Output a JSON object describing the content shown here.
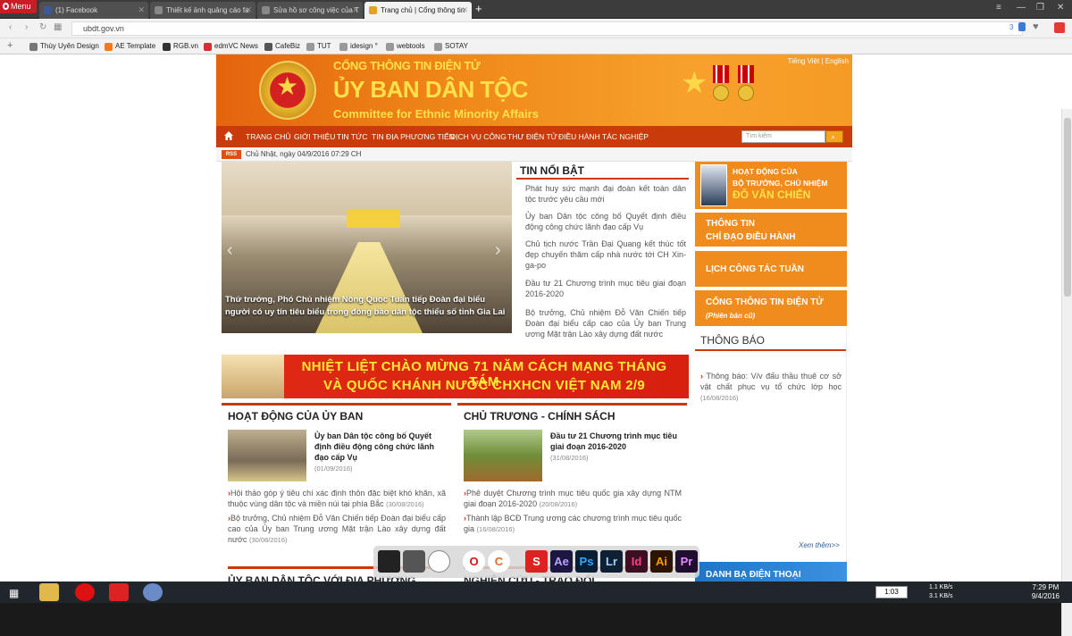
{
  "browser": {
    "menu_label": "Menu",
    "tabs": [
      {
        "label": "(1) Facebook",
        "color": "#3b5998"
      },
      {
        "label": "Thiết kế ảnh quảng cáo fa",
        "color": "#888888"
      },
      {
        "label": "Sửa hồ sơ công việc của T",
        "color": "#888888"
      },
      {
        "label": "Trang chủ | Cổng thông tin",
        "color": "#e8a020"
      }
    ],
    "new_tab": "+",
    "url": "ubdt.gov.vn",
    "badge_count": "3",
    "bookmarks": [
      {
        "label": "Thùy Uyên Design",
        "color": "#777777"
      },
      {
        "label": "AE Template",
        "color": "#f07b1e"
      },
      {
        "label": "RGB.vn",
        "color": "#333333"
      },
      {
        "label": "edmVC News",
        "color": "#d32f2f"
      },
      {
        "label": "CafeBiz",
        "color": "#555555"
      },
      {
        "label": "TUT",
        "color": "#777777"
      },
      {
        "label": "idesign °",
        "color": "#777777"
      },
      {
        "label": "webtools",
        "color": "#777777"
      },
      {
        "label": "SOTAY",
        "color": "#777777"
      }
    ]
  },
  "site": {
    "banner": {
      "line1": "CỔNG THÔNG TIN ĐIỆN TỬ",
      "line2": "ỦY BAN DÂN TỘC",
      "line3": "Committee for Ethnic Minority Affairs",
      "lang_vi": "Tiếng Việt",
      "lang_sep": "|",
      "lang_en": "English"
    },
    "nav": [
      "TRANG CHỦ",
      "GIỚI THIỆU",
      "TIN TỨC",
      "TIN ĐỊA PHƯƠNG TIỂN",
      "DỊCH VỤ CÔNG",
      "THƯ ĐIỆN TỬ",
      "ĐIỀU HÀNH TÁC NGHIỆP"
    ],
    "search_placeholder": "Tìm kiếm",
    "rss": "RSS",
    "date": "Chủ Nhật, ngày 04/9/2016 07:29 CH",
    "slider_caption": "Thứ trưởng, Phó Chủ nhiệm Nông Quốc Tuấn tiếp Đoàn đại biểu người có uy tín tiêu biểu trong đồng bào dân tộc thiểu số tỉnh Gia Lai",
    "featured": {
      "title": "TIN NỔI BẬT",
      "items": [
        "Phát huy sức mạnh đại đoàn kết toàn dân tộc trước yêu cầu mới",
        "Ủy ban Dân tộc công bố Quyết định điều động công chức lãnh đạo cấp Vụ",
        "Chủ tịch nước Trần Đại Quang kết thúc tốt đẹp chuyến thăm cấp nhà nước tới CH Xin-ga-po",
        "Đầu tư 21 Chương trình mục tiêu giai đoạn 2016-2020",
        "Bộ trưởng, Chủ nhiệm Đỗ Văn Chiến tiếp Đoàn đại biểu cấp cao của Ủy ban Trung ương Mặt trận Lào xây dựng đất nước"
      ]
    },
    "minister": {
      "l1": "HOẠT ĐỘNG CỦA",
      "l2": "BỘ TRƯỞNG, CHỦ NHIỆM",
      "l3": "ĐỖ VĂN CHIẾN"
    },
    "right_boxes": [
      {
        "l1": "THÔNG TIN",
        "l2": "CHỈ ĐẠO ĐIỀU HÀNH"
      },
      {
        "l1": "LỊCH CÔNG TÁC TUẦN",
        "l2": ""
      },
      {
        "l1": "CỔNG THÔNG TIN ĐIỆN TỬ",
        "l2": "(Phiên bản cũ)"
      }
    ],
    "notice": {
      "title": "THÔNG BÁO",
      "item": "Thông báo: V/v đấu thầu thuê cơ sở vật chất phục vụ tổ chức lớp học",
      "date": "(16/08/2016)",
      "more": "Xem thêm>>"
    },
    "phonebook": "DANH BẠ ĐIỆN THOẠI",
    "greeting": {
      "l1": "NHIỆT LIỆT CHÀO MỪNG 71 NĂM CÁCH MẠNG THÁNG TÁM",
      "l2": "VÀ QUỐC KHÁNH NƯỚC CHXHCN VIỆT NAM 2/9"
    },
    "sec1": {
      "title": "HOẠT ĐỘNG CỦA ỦY BAN",
      "feature": "Ủy ban Dân tộc công bố Quyết định điều động công chức lãnh đạo cấp Vụ",
      "feature_date": "(01/09/2016)",
      "items": [
        {
          "text": "Hội thảo góp ý tiêu chí xác định thôn đặc biệt khó khăn, xã thuộc vùng dân tộc và miền núi tại phía Bắc",
          "date": "(30/08/2016)"
        },
        {
          "text": "Bộ trưởng, Chủ nhiệm Đỗ Văn Chiến tiếp Đoàn đại biểu cấp cao của Ủy ban Trung ương Mặt trận Lào xây dựng đất nước",
          "date": "(30/08/2016)"
        }
      ],
      "next_title": "ỦY BAN DÂN TỘC VỚI ĐỊA PHƯƠNG"
    },
    "sec2": {
      "title": "CHỦ TRƯƠNG - CHÍNH SÁCH",
      "feature": "Đầu tư 21 Chương trình mục tiêu giai đoạn 2016-2020",
      "feature_date": "(31/08/2016)",
      "items": [
        {
          "text": "Phê duyệt Chương trình mục tiêu quốc gia xây dựng NTM giai đoạn 2016-2020",
          "date": "(20/08/2016)"
        },
        {
          "text": "Thành lập BCĐ Trung ương các chương trình mục tiêu quốc gia",
          "date": "(16/08/2016)"
        }
      ],
      "next_title": "NGHIÊN CỨU - TRAO ĐỔI"
    }
  },
  "dock": [
    "Ae",
    "Ps",
    "Lr",
    "Id",
    "Ai",
    "Pr"
  ],
  "taskbar": {
    "timer": "1:03",
    "net_up": "1.1 KB/s",
    "net_down": "3.1 KB/s",
    "time": "7:29 PM",
    "date": "9/4/2016"
  }
}
